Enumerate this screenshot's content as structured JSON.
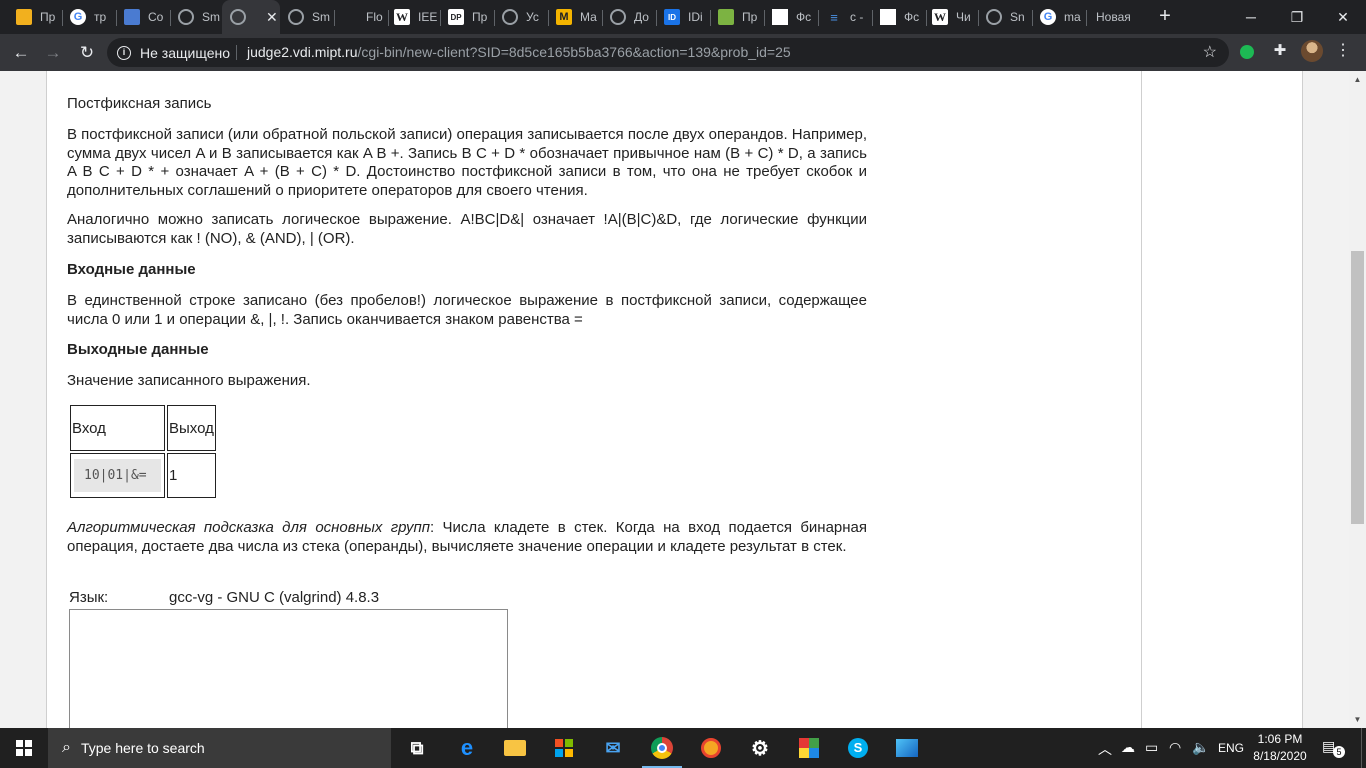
{
  "browser": {
    "tabs": [
      {
        "title": "Пр",
        "icon": "yellow-bars-icon"
      },
      {
        "title": "тр",
        "icon": "google-icon"
      },
      {
        "title": "Co",
        "icon": "chat-icon"
      },
      {
        "title": "Sm",
        "icon": "globe-icon"
      },
      {
        "title": "",
        "icon": "globe-icon",
        "active": true
      },
      {
        "title": "Sm",
        "icon": "globe-icon"
      },
      {
        "title": "Flo",
        "icon": "blank-icon"
      },
      {
        "title": "IEE",
        "icon": "wikipedia-icon"
      },
      {
        "title": "Пр",
        "icon": "dp-icon"
      },
      {
        "title": "Ус",
        "icon": "globe-icon"
      },
      {
        "title": "Ма",
        "icon": "m-icon"
      },
      {
        "title": "До",
        "icon": "globe-icon"
      },
      {
        "title": "IDi",
        "icon": "id-icon"
      },
      {
        "title": "Пр",
        "icon": "book-icon"
      },
      {
        "title": "Фс",
        "icon": "doc-icon"
      },
      {
        "title": "c -",
        "icon": "stackoverflow-icon"
      },
      {
        "title": "Фс",
        "icon": "doc-icon"
      },
      {
        "title": "Чи",
        "icon": "wikipedia-icon"
      },
      {
        "title": "Sn",
        "icon": "globe-icon"
      },
      {
        "title": "ma",
        "icon": "google-icon"
      },
      {
        "title": "Новая",
        "icon": "none"
      }
    ],
    "security_label": "Не защищено",
    "url_host": "judge2.vdi.mipt.ru",
    "url_rest": "/cgi-bin/new-client?SID=8d5ce165b5ba3766&action=139&prob_id=25"
  },
  "problem": {
    "title": "Постфиксная запись",
    "para1": "В постфиксной записи (или обратной польской записи) операция записывается после двух операндов. Например, сумма двух чисел A и B записывается как A B +. Запись B C + D * обозначает привычное нам (B + C) * D, а запись A B C + D * + означает A + (B + C) * D. Достоинство постфиксной записи в том, что она не требует скобок и дополнительных соглашений о приоритете операторов для своего чтения.",
    "para2": "Аналогично можно записать логическое выражение. A!BC|D&| означает !A|(B|C)&D, где логические функции записываются как ! (NO), & (AND), | (OR).",
    "input_header": "Входные данные",
    "input_text": "В единственной строке записано (без пробелов!) логическое выражение в постфиксной записи, содержащее числа 0 или 1 и операции &, |, !. Запись оканчивается знаком равенства =",
    "output_header": "Выходные данные",
    "output_text": "Значение записанного выражения.",
    "samples": {
      "col_input": "Вход",
      "col_output": "Выход",
      "rows": [
        {
          "input": "10|01|&=",
          "output": "1"
        }
      ]
    },
    "hint_label": "Алгоритмическая подсказка для основных групп",
    "hint_text": ": Числа кладете в стек. Когда на вход подается бинарная операция, достаете два числа из стека (операнды), вычисляете значение операции и кладете результат в стек.",
    "language_label": "Язык:",
    "language_value": "gcc-vg - GNU C (valgrind) 4.8.3"
  },
  "taskbar": {
    "search_placeholder": "Type here to search",
    "lang": "ENG",
    "time": "1:06 PM",
    "date": "8/18/2020",
    "notification_count": "5"
  }
}
